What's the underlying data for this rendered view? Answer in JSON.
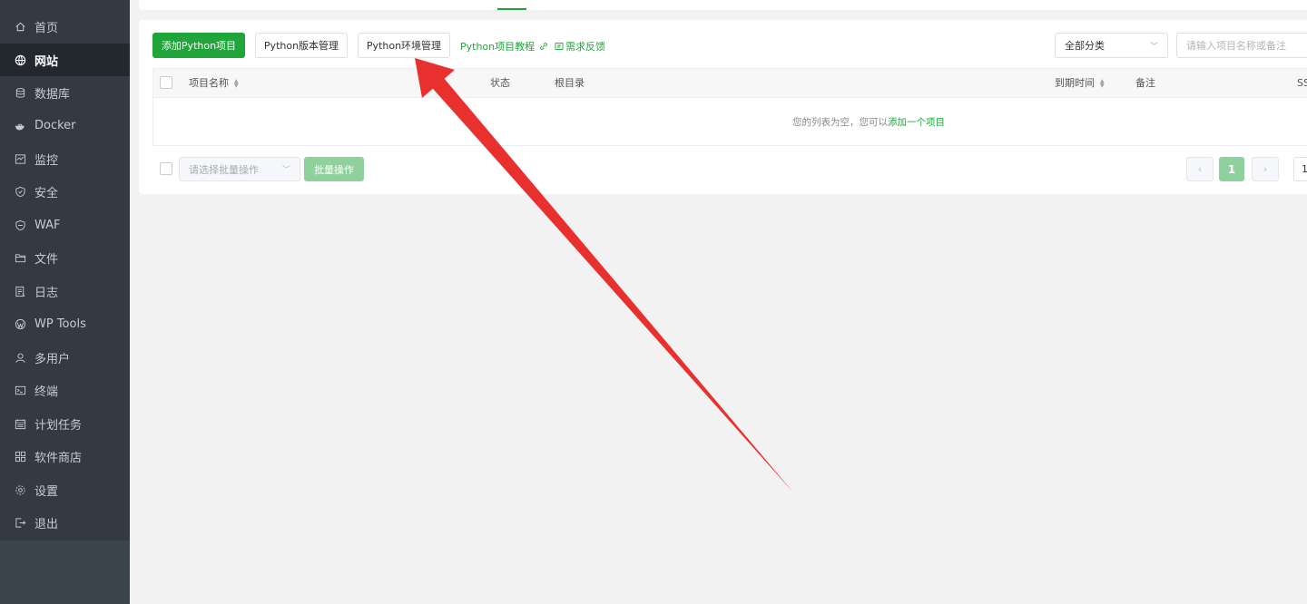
{
  "sidebar": {
    "items": [
      {
        "label": "首页",
        "icon": "home-icon"
      },
      {
        "label": "网站",
        "icon": "globe-icon",
        "active": true
      },
      {
        "label": "数据库",
        "icon": "database-icon"
      },
      {
        "label": "Docker",
        "icon": "docker-icon"
      },
      {
        "label": "监控",
        "icon": "monitor-icon"
      },
      {
        "label": "安全",
        "icon": "shield-icon"
      },
      {
        "label": "WAF",
        "icon": "waf-shield-icon"
      },
      {
        "label": "文件",
        "icon": "folder-icon"
      },
      {
        "label": "日志",
        "icon": "log-icon"
      },
      {
        "label": "WP Tools",
        "icon": "wordpress-icon"
      },
      {
        "label": "多用户",
        "icon": "users-icon"
      },
      {
        "label": "终端",
        "icon": "terminal-icon"
      },
      {
        "label": "计划任务",
        "icon": "calendar-icon"
      },
      {
        "label": "软件商店",
        "icon": "apps-grid-icon"
      },
      {
        "label": "设置",
        "icon": "gear-icon"
      },
      {
        "label": "退出",
        "icon": "logout-icon"
      }
    ]
  },
  "toolbar": {
    "add_project": "添加Python项目",
    "version_manage": "Python版本管理",
    "env_manage": "Python环境管理",
    "tutorial_link": "Python项目教程",
    "feedback_link": "需求反馈",
    "category_select": "全部分类",
    "search_placeholder": "请输入项目名称或备注"
  },
  "table": {
    "columns": {
      "name": "项目名称",
      "status": "状态",
      "root": "根目录",
      "expire": "到期时间",
      "remark": "备注",
      "ssl": "SS"
    },
    "empty_text": "您的列表为空，您可以",
    "empty_link": "添加一个项目"
  },
  "footer": {
    "batch_placeholder": "请选择批量操作",
    "batch_button": "批量操作",
    "prev": "‹",
    "current_page": "1",
    "next": "›",
    "page_size": "1"
  },
  "colors": {
    "accent": "#20a53a",
    "annotation_arrow": "#e8312f"
  }
}
